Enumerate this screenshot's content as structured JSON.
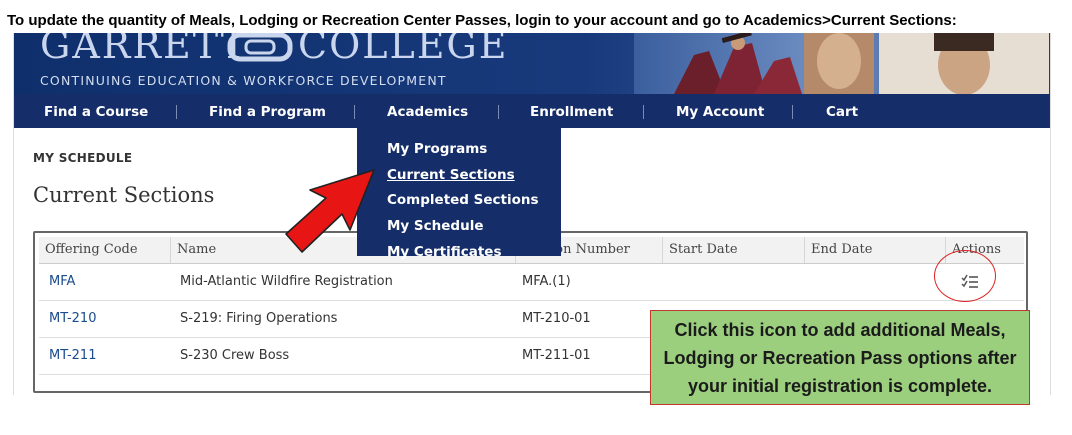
{
  "instruction": "To update the quantity of Meals, Lodging or Recreation Center Passes, login to your account and go to Academics>Current Sections:",
  "header": {
    "college_name_left": "GARRETT",
    "college_name_right": "COLLEGE",
    "tagline": "CONTINUING EDUCATION & WORKFORCE DEVELOPMENT"
  },
  "nav": {
    "items": [
      {
        "label": "Find a Course"
      },
      {
        "label": "Find a Program"
      },
      {
        "label": "Academics"
      },
      {
        "label": "Enrollment"
      },
      {
        "label": "My Account"
      },
      {
        "label": "Cart"
      }
    ]
  },
  "dropdown": {
    "items": [
      {
        "label": "My Programs"
      },
      {
        "label": "Current Sections"
      },
      {
        "label": "Completed Sections"
      },
      {
        "label": "My Schedule"
      },
      {
        "label": "My Certificates"
      }
    ]
  },
  "breadcrumb": "MY SCHEDULE",
  "page_title": "Current Sections",
  "table": {
    "headers": [
      "Offering Code",
      "Name",
      "Section Number",
      "Start Date",
      "End Date",
      "Actions"
    ],
    "rows": [
      {
        "code": "MFA",
        "name": "Mid-Atlantic Wildfire Registration",
        "section": "MFA.(1)"
      },
      {
        "code": "MT-210",
        "name": "S-219: Firing Operations",
        "section": "MT-210-01"
      },
      {
        "code": "MT-211",
        "name": "S-230 Crew Boss",
        "section": "MT-211-01"
      }
    ]
  },
  "callout": {
    "line1": "Click this icon to add additional Meals,",
    "line2": "Lodging or Recreation Pass options after",
    "line3": "your initial registration is complete."
  },
  "colors": {
    "navy": "#152d68",
    "link": "#1a4b8c",
    "callout_bg": "#9bcf7e",
    "annotation_red": "#e01010"
  },
  "icons": [
    "college-logo-icon",
    "checklist-icon",
    "red-arrow"
  ]
}
